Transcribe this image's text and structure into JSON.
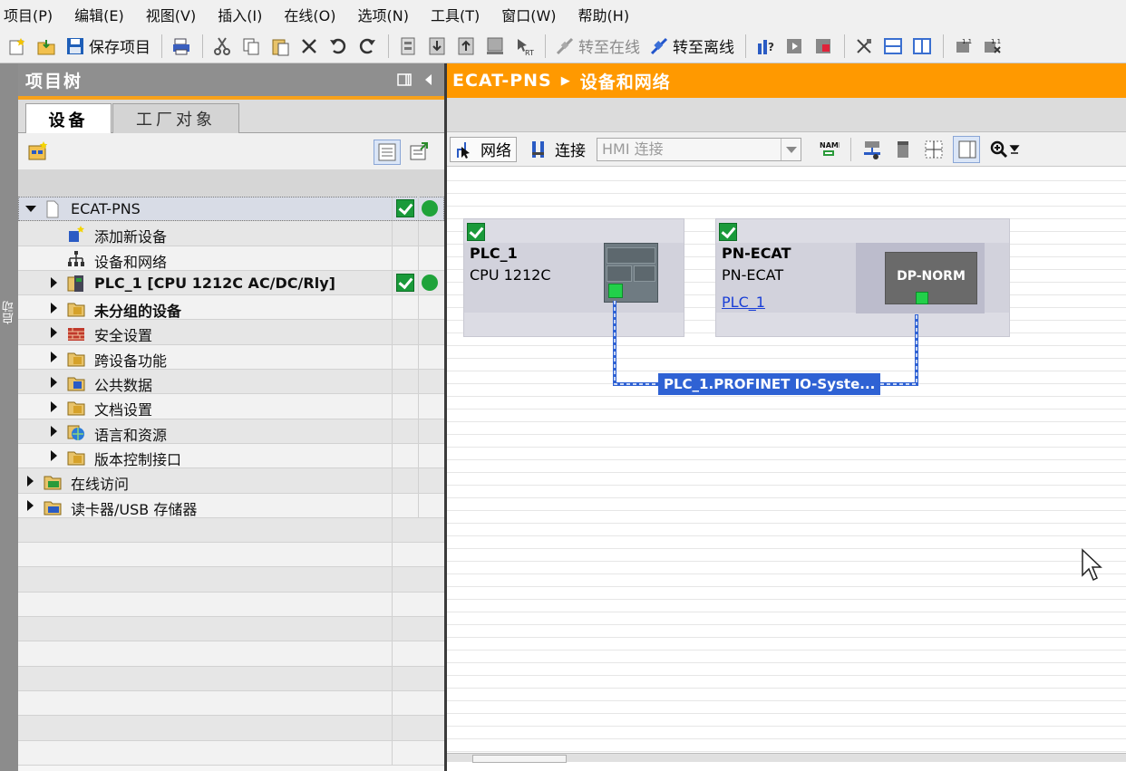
{
  "menu": [
    "项目(P)",
    "编辑(E)",
    "视图(V)",
    "插入(I)",
    "在线(O)",
    "选项(N)",
    "工具(T)",
    "窗口(W)",
    "帮助(H)"
  ],
  "toolbar": {
    "save_label": "保存项目",
    "go_online_label": "转至在线",
    "go_offline_label": "转至离线"
  },
  "side_strip": {
    "label": "启动"
  },
  "project_tree": {
    "title": "项目树",
    "tabs": [
      "设备",
      "工厂对象"
    ],
    "rows": [
      {
        "label": "ECAT-PNS",
        "bold": false,
        "level": 0,
        "expanded": true,
        "check": true,
        "dot": true,
        "icon": "project-icon"
      },
      {
        "label": "添加新设备",
        "bold": false,
        "level": 1,
        "expanded": null,
        "check": false,
        "dot": false,
        "icon": "add-device-icon"
      },
      {
        "label": "设备和网络",
        "bold": false,
        "level": 1,
        "expanded": null,
        "check": false,
        "dot": false,
        "icon": "network-icon"
      },
      {
        "label": "PLC_1 [CPU 1212C AC/DC/Rly]",
        "bold": true,
        "level": 1,
        "expanded": false,
        "check": true,
        "dot": true,
        "icon": "plc-icon"
      },
      {
        "label": "未分组的设备",
        "bold": true,
        "level": 1,
        "expanded": false,
        "check": false,
        "dot": false,
        "icon": "ungrouped-devices-icon"
      },
      {
        "label": "安全设置",
        "bold": false,
        "level": 1,
        "expanded": false,
        "check": false,
        "dot": false,
        "icon": "security-icon"
      },
      {
        "label": "跨设备功能",
        "bold": false,
        "level": 1,
        "expanded": false,
        "check": false,
        "dot": false,
        "icon": "cross-device-icon"
      },
      {
        "label": "公共数据",
        "bold": false,
        "level": 1,
        "expanded": false,
        "check": false,
        "dot": false,
        "icon": "common-data-icon"
      },
      {
        "label": "文档设置",
        "bold": false,
        "level": 1,
        "expanded": false,
        "check": false,
        "dot": false,
        "icon": "document-settings-icon"
      },
      {
        "label": "语言和资源",
        "bold": false,
        "level": 1,
        "expanded": false,
        "check": false,
        "dot": false,
        "icon": "language-icon"
      },
      {
        "label": "版本控制接口",
        "bold": false,
        "level": 1,
        "expanded": false,
        "check": false,
        "dot": false,
        "icon": "version-control-icon"
      },
      {
        "label": "在线访问",
        "bold": false,
        "level": 0,
        "expanded": false,
        "check": false,
        "dot": false,
        "icon": "online-access-icon"
      },
      {
        "label": "读卡器/USB 存储器",
        "bold": false,
        "level": 0,
        "expanded": false,
        "check": false,
        "dot": false,
        "icon": "card-reader-icon"
      }
    ]
  },
  "editor": {
    "breadcrumb_project": "ECAT-PNS",
    "breadcrumb_view": "设备和网络",
    "network_label": "网络",
    "connections_label": "连接",
    "connection_type": "HMI 连接"
  },
  "devices": [
    {
      "name": "PLC_1",
      "type": "CPU 1212C",
      "link": ""
    },
    {
      "name": "PN-ECAT",
      "type": "PN-ECAT",
      "link": "PLC_1",
      "module_label": "DP-NORM"
    }
  ],
  "network": {
    "label": "PLC_1.PROFINET IO-Syste..."
  },
  "colors": {
    "accent": "#ff9900",
    "bus": "#2f62d4",
    "status_ok": "#1fa33a"
  }
}
